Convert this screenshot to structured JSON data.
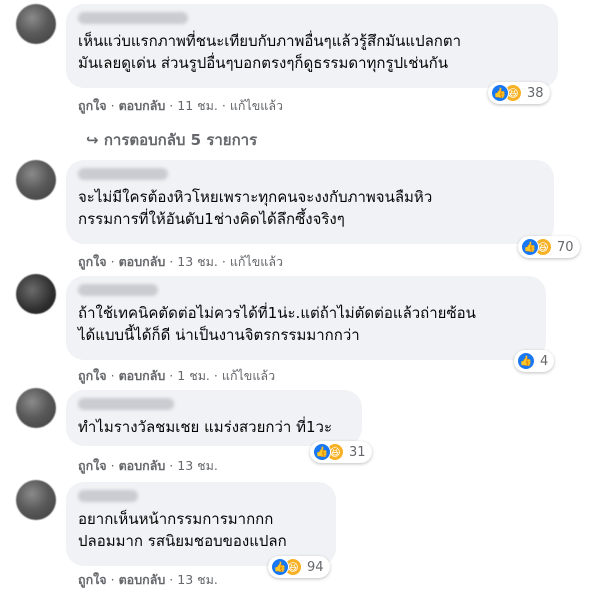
{
  "comments": [
    {
      "text": "เห็นแว่บแรกภาพที่ชนะเทียบกับภาพอื่นๆแล้วรู้สึกมันแปลกตา\nมันเลยดูเด่น ส่วนรูปอื่นๆบอกตรงๆก็ดูธรรมดาทุกรูปเช่นกัน",
      "like": "ถูกใจ",
      "reply": "ตอบกลับ",
      "time": "11 ชม.",
      "edited": "แก้ไขแล้ว",
      "reaction_count": "38",
      "reactions": [
        "like-icon",
        "haha-icon"
      ]
    },
    {
      "text": "จะไม่มีใครต้องหิวโหยเพราะทุกคนจะงงกับภาพจนลืมหิว\nกรรมการที่ให้อันดับ1ช่างคิดได้ลึกซึ้งจริงๆ",
      "like": "ถูกใจ",
      "reply": "ตอบกลับ",
      "time": "13 ชม.",
      "edited": "แก้ไขแล้ว",
      "reaction_count": "70",
      "reactions": [
        "like-icon",
        "haha-icon"
      ]
    },
    {
      "text": "ถ้าใช้เทคนิคตัดต่อไม่ควรได้ที่1น่ะ.แต่ถ้าไม่ตัดต่อแล้วถ่ายซ้อน\nได้แบบนี้ได้ก็ดี น่าเป็นงานจิตรกรรมมากกว่า",
      "like": "ถูกใจ",
      "reply": "ตอบกลับ",
      "time": "1 ชม.",
      "edited": "แก้ไขแล้ว",
      "reaction_count": "4",
      "reactions": [
        "like-icon"
      ]
    },
    {
      "text": "ทำไมรางวัลชมเชย แมร่งสวยกว่า ที่1วะ",
      "like": "ถูกใจ",
      "reply": "ตอบกลับ",
      "time": "13 ชม.",
      "reaction_count": "31",
      "reactions": [
        "like-icon",
        "haha-icon"
      ]
    },
    {
      "text": "อยากเห็นหน้ากรรมการมากกก\nปลอมมาก รสนิยมชอบของแปลก",
      "like": "ถูกใจ",
      "reply": "ตอบกลับ",
      "time": "13 ชม.",
      "reaction_count": "94",
      "reactions": [
        "like-icon",
        "haha-icon"
      ]
    }
  ],
  "replies_link": "การตอบกลับ 5 รายการ",
  "replies_arrow": "↪",
  "colors": {
    "bubble": "#f0f2f5",
    "meta": "#65676b",
    "like": "#1877f2",
    "haha": "#f7b125"
  }
}
